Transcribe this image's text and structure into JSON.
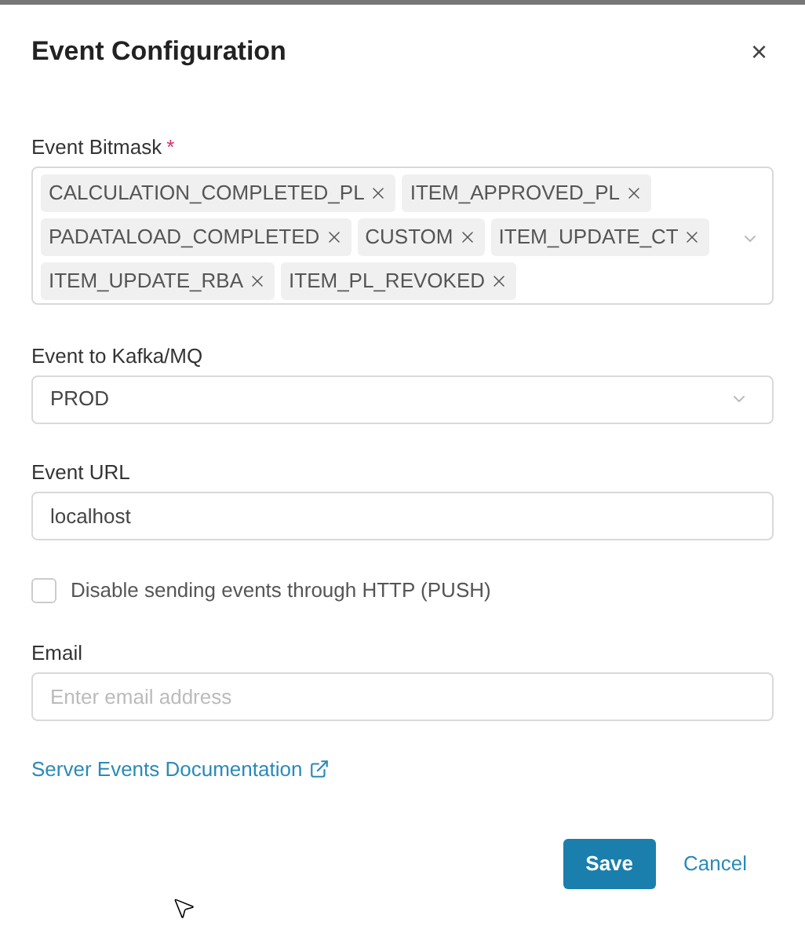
{
  "dialog": {
    "title": "Event Configuration",
    "close": "×"
  },
  "bitmask": {
    "label": "Event Bitmask",
    "required_mark": "*",
    "tags": [
      {
        "label": "CALCULATION_COMPLETED_PL"
      },
      {
        "label": "ITEM_APPROVED_PL"
      },
      {
        "label": "PADATALOAD_COMPLETED"
      },
      {
        "label": "CUSTOM"
      },
      {
        "label": "ITEM_UPDATE_CT"
      },
      {
        "label": "ITEM_UPDATE_RBA"
      },
      {
        "label": "ITEM_PL_REVOKED"
      }
    ]
  },
  "kafka": {
    "label": "Event to Kafka/MQ",
    "value": "PROD"
  },
  "url": {
    "label": "Event URL",
    "value": "localhost"
  },
  "disable_http": {
    "label": "Disable sending events through HTTP (PUSH)",
    "checked": false
  },
  "email": {
    "label": "Email",
    "placeholder": "Enter email address"
  },
  "doc_link": "Server Events Documentation",
  "buttons": {
    "save": "Save",
    "cancel": "Cancel"
  }
}
